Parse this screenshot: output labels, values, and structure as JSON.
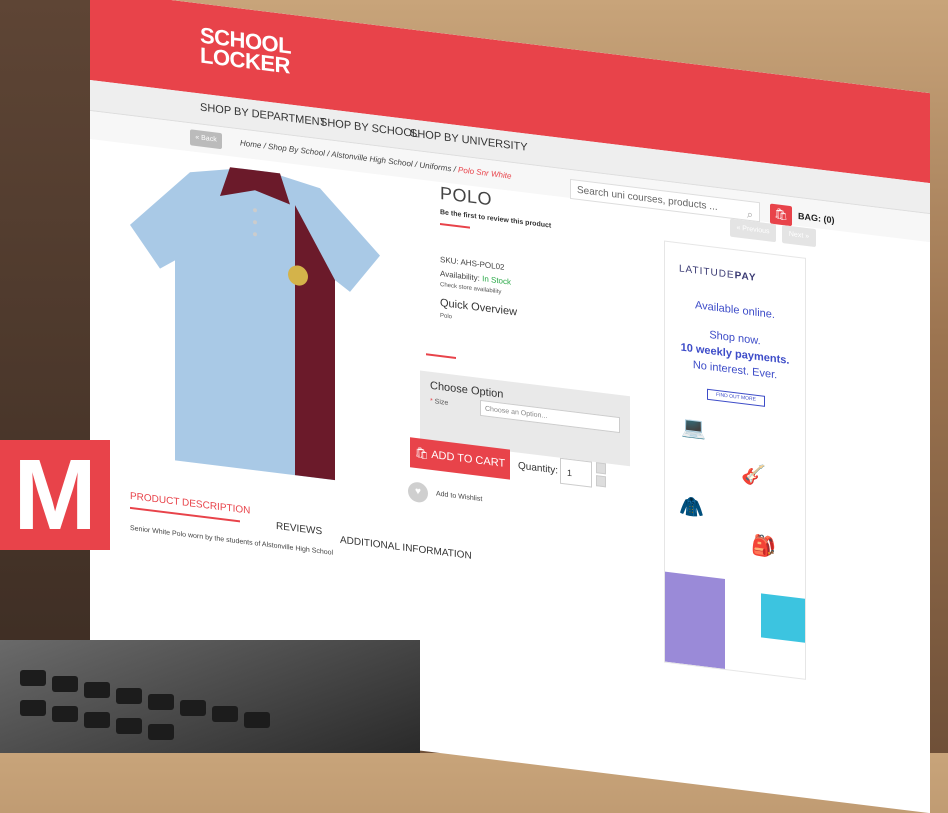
{
  "header": {
    "logo_line1": "SCHOOL",
    "logo_line2": "LOCKER"
  },
  "nav": {
    "items": [
      "SHOP BY DEPARTMENT",
      "SHOP BY SCHOOL",
      "SHOP BY UNIVERSITY"
    ]
  },
  "breadcrumb": {
    "back": "« Back",
    "path": "Home / Shop By School / Alstonville High School / Uniforms / ",
    "current": "Polo Snr White"
  },
  "search": {
    "placeholder": "Search uni courses, products ..."
  },
  "bag": {
    "label": "BAG: (0)"
  },
  "product": {
    "title": "POLO",
    "review_prompt": "Be the first to review this product",
    "sku": "SKU: AHS-POL02",
    "availability_label": "Availability: ",
    "availability_value": "In Stock",
    "check_store": "Check store availability",
    "quick_overview_title": "Quick Overview",
    "quick_overview_text": "Polo",
    "choose_option_title": "Choose Option",
    "size_required": "*",
    "size_label": " Size",
    "size_placeholder": "Choose an Option...",
    "add_to_cart": "ADD TO CART",
    "quantity_label": "Quantity:",
    "quantity_value": "1",
    "wishlist": "Add to Wishlist"
  },
  "pager": {
    "previous": "« Previous",
    "next": "Next »"
  },
  "ad": {
    "brand_prefix": "LATITUDE",
    "brand_suffix": "PAY",
    "line1": "Available online.",
    "line2": "Shop now.",
    "line3": "10 weekly payments.",
    "line4": "No interest. Ever.",
    "cta": "FIND OUT MORE",
    "accent_color": "#3d4cc8"
  },
  "tabs": [
    "PRODUCT DESCRIPTION",
    "REVIEWS",
    "ADDITIONAL INFORMATION"
  ],
  "description": "Senior White Polo worn by the students of Alstonville High School",
  "overlay_logo": {
    "letter": "M",
    "color": "#e8434a"
  },
  "colors": {
    "brand_red": "#e8434a",
    "in_stock_green": "#27a845"
  }
}
